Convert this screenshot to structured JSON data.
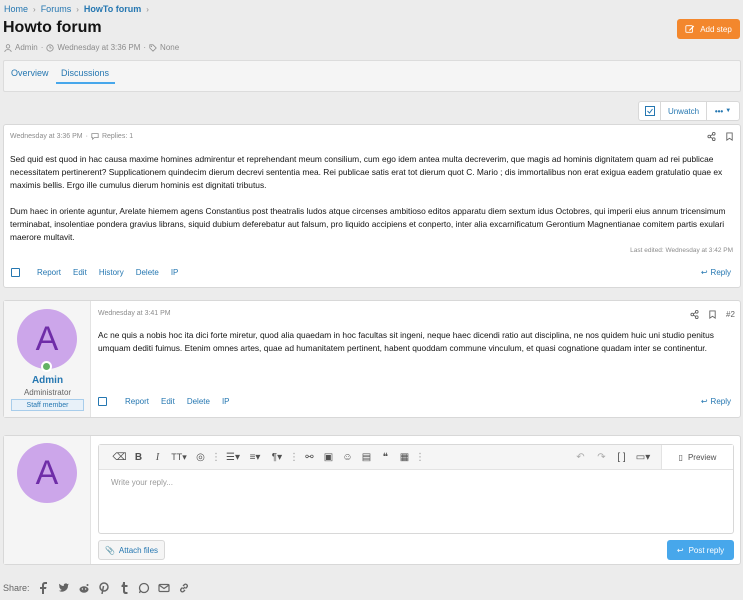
{
  "breadcrumb": [
    "Home",
    "Forums",
    "HowTo forum"
  ],
  "title": "Howto forum",
  "meta": {
    "author": "Admin",
    "date": "Wednesday at 3:36 PM",
    "tags": "None"
  },
  "add_step": "Add step",
  "tabs": [
    "Overview",
    "Discussions"
  ],
  "unwatch": "Unwatch",
  "more": "•••",
  "post1": {
    "date": "Wednesday at 3:36 PM",
    "replies": "Replies: 1",
    "para1": "Sed quid est quod in hac causa maxime homines admirentur et reprehendant meum consilium, cum ego idem antea multa decreverim, que magis ad hominis dignitatem quam ad rei publicae necessitatem pertinerent? Supplicationem quindecim dierum decrevi sententia mea. Rei publicae satis erat tot dierum quot C. Mario ; dis immortalibus non erat exigua eadem gratulatio quae ex maximis bellis. Ergo ille cumulus dierum hominis est dignitati tributus.",
    "para2": "Dum haec in oriente aguntur, Arelate hiemem agens Constantius post theatralis ludos atque circenses ambitioso editos apparatu diem sextum idus Octobres, qui imperii eius annum tricensimum terminabat, insolentiae pondera gravius librans, siquid dubium deferebatur aut falsum, pro liquido accipiens et conperto, inter alia excarnificatum Gerontium Magnentianae comitem partis exulari maerore multavit.",
    "edited": "Last edited: Wednesday at 3:42 PM",
    "actions": [
      "Report",
      "Edit",
      "History",
      "Delete",
      "IP"
    ],
    "reply": "Reply"
  },
  "post2": {
    "date": "Wednesday at 3:41 PM",
    "number": "#2",
    "user": {
      "initial": "A",
      "name": "Admin",
      "title": "Administrator",
      "banner": "Staff member"
    },
    "body": "Ac ne quis a nobis hoc ita dici forte miretur, quod alia quaedam in hoc facultas sit ingeni, neque haec dicendi ratio aut disciplina, ne nos quidem huic uni studio penitus umquam dediti fuimus. Etenim omnes artes, quae ad humanitatem pertinent, habent quoddam commune vinculum, et quasi cognatione quadam inter se continentur.",
    "actions": [
      "Report",
      "Edit",
      "Delete",
      "IP"
    ],
    "reply": "Reply"
  },
  "editor": {
    "avatar_initial": "A",
    "placeholder": "Write your reply...",
    "preview": "Preview",
    "attach": "Attach files",
    "post_reply": "Post reply"
  },
  "share_label": "Share:",
  "colors": {
    "accent": "#2577b1",
    "orange": "#f3872d",
    "button_blue": "#47a7eb",
    "avatar_bg": "#cca6ea",
    "avatar_fg": "#6f2da8"
  }
}
